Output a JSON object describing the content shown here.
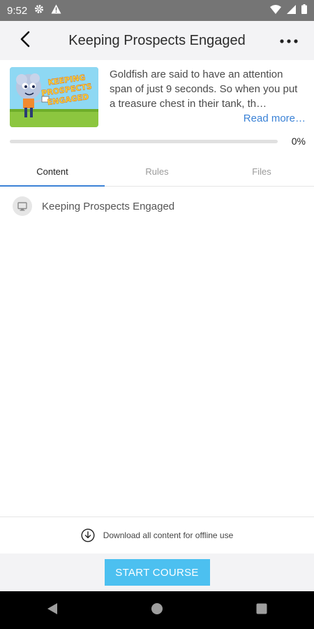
{
  "status_bar": {
    "time": "9:52",
    "icons_left": [
      "gear-icon",
      "warning-icon"
    ],
    "icons_right": [
      "wifi-icon",
      "signal-icon",
      "battery-icon"
    ]
  },
  "header": {
    "title": "Keeping Prospects Engaged",
    "back_icon": "chevron-left-icon",
    "menu_icon": "more-horizontal-icon"
  },
  "course": {
    "thumbnail_text": "KEEPING PROSPECTS ENGAGED",
    "description": "Goldfish are said to have an attention span of just 9 seconds. So when you put a treasure chest in their tank, th…",
    "read_more": "Read more…",
    "progress": 0,
    "progress_label": "0%"
  },
  "tabs": [
    {
      "label": "Content",
      "active": true
    },
    {
      "label": "Rules",
      "active": false
    },
    {
      "label": "Files",
      "active": false
    }
  ],
  "content_items": [
    {
      "label": "Keeping Prospects Engaged",
      "icon": "monitor-icon"
    }
  ],
  "download": {
    "label": "Download all content for offline use",
    "icon": "download-circle-icon"
  },
  "footer": {
    "start_label": "START COURSE"
  },
  "colors": {
    "accent": "#3b82d6",
    "button": "#4cc0f0",
    "status_bar": "#757575",
    "header_bg": "#f3f3f5"
  },
  "nav_bar": {
    "icons": [
      "back-triangle-icon",
      "home-circle-icon",
      "recents-square-icon"
    ]
  }
}
